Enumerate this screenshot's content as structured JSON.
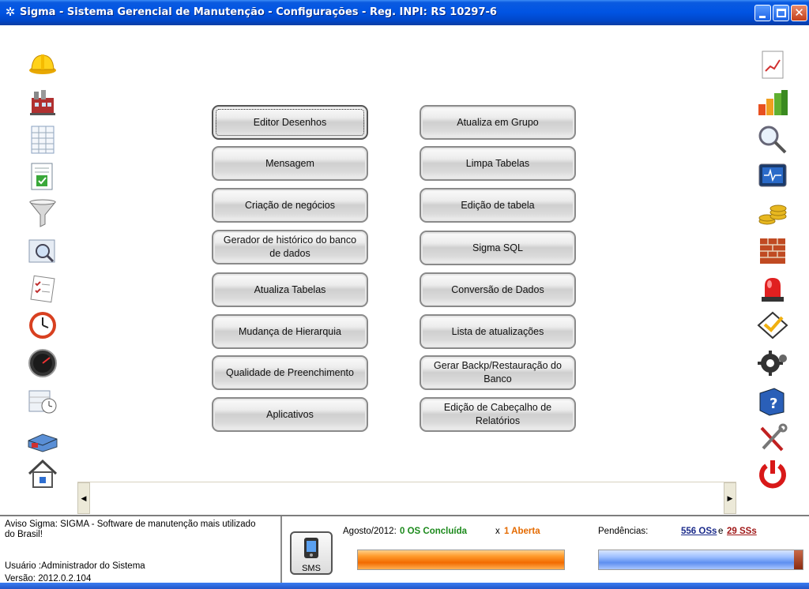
{
  "window": {
    "title": "Sigma - Sistema Gerencial de Manutenção - Configurações - Reg. INPI: RS 10297-6",
    "title_icon": "gear-icon"
  },
  "left_icons": [
    "worker-helmet-icon",
    "factory-icon",
    "spreadsheet-icon",
    "checklist-document-icon",
    "funnel-icon",
    "magnifier-document-icon",
    "task-list-icon",
    "clock-icon",
    "speedometer-icon",
    "calendar-clock-icon",
    "warehouse-icon",
    "home-icon"
  ],
  "right_icons": [
    "report-chart-icon",
    "bar-chart-icon",
    "search-icon",
    "monitor-icon",
    "coins-icon",
    "bricks-icon",
    "alarm-light-icon",
    "checkmark-icon",
    "gears-icon",
    "help-book-icon",
    "tools-icon",
    "power-icon"
  ],
  "buttons_left": [
    "Editor Desenhos",
    "Mensagem",
    "Criação de negócios",
    "Gerador de histórico do banco de dados",
    "Atualiza Tabelas",
    "Mudança de Hierarquia",
    "Qualidade de Preenchimento",
    "Aplicativos"
  ],
  "buttons_right": [
    "Atualiza em Grupo",
    "Limpa Tabelas",
    "Edição de tabela",
    "Sigma SQL",
    "Conversão de Dados",
    "Lista de atualizações",
    "Gerar Backp/Restauração do Banco",
    "Edição de Cabeçalho de Relatórios"
  ],
  "scroll": {
    "left_arrow": "◀",
    "right_arrow": "▶"
  },
  "status": {
    "aviso": "Aviso Sigma: SIGMA - Software de manutenção mais utilizado do Brasil!",
    "usuario": "Usuário :Administrador do Sistema",
    "versao": "Versão: 2012.0.2.104",
    "sms_label": "SMS",
    "month_label": "Agosto/2012:",
    "concluded": "0 OS Concluída",
    "x_label": "x",
    "open": "1 Aberta",
    "pendencias_label": "Pendências:",
    "pend_os": "556 OSs",
    "e_label": "e",
    "pend_ss": "29 SSs"
  },
  "colors": {
    "titlebar": "#0054e3",
    "concluded": "#1c8a1c",
    "open": "#e46a00",
    "orange_bar": "#f26a00",
    "blue_bar": "#5e8ff0"
  }
}
